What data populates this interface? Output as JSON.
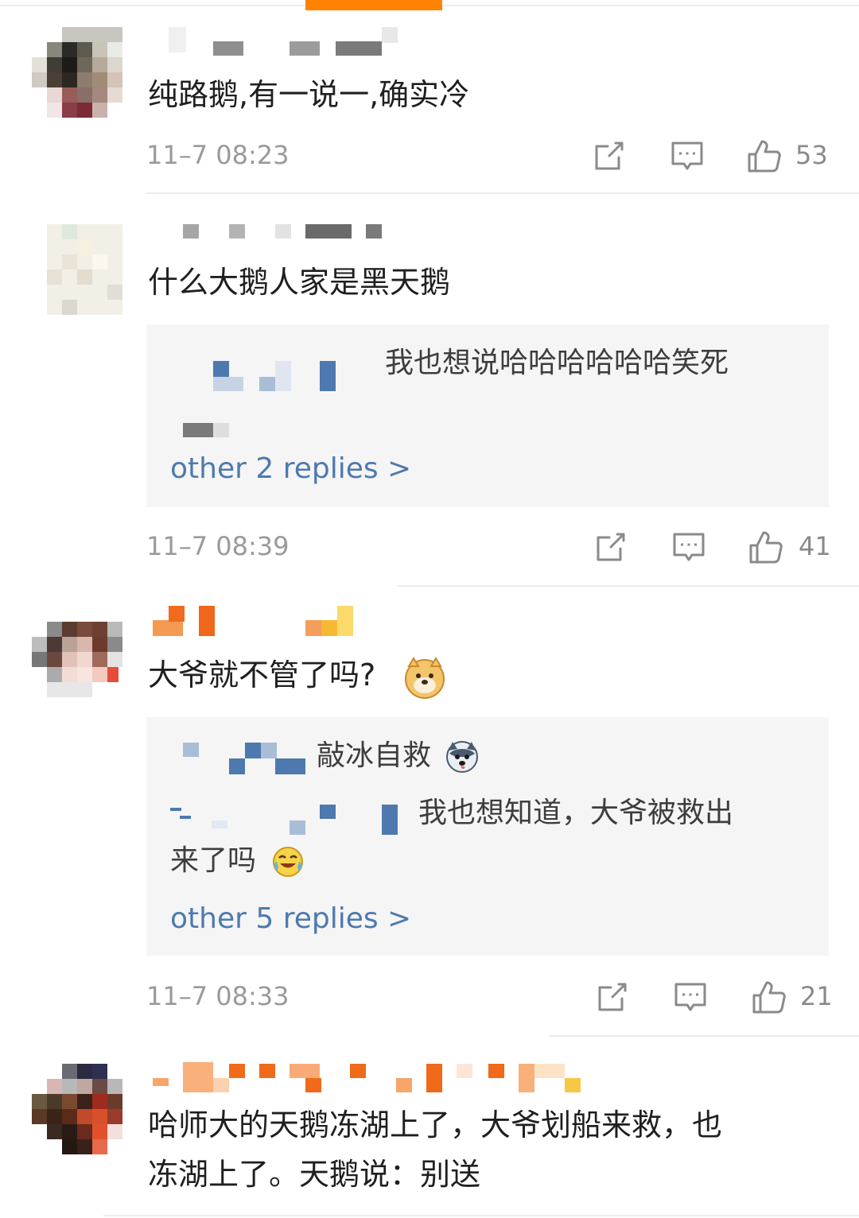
{
  "comments": [
    {
      "text": "纯路鹅,有一说一,确实冷",
      "time": "11–7 08:23",
      "likes": "53"
    },
    {
      "text": "什么大鹅人家是黑天鹅",
      "reply_preview": "我也想说哈哈哈哈哈哈笑死",
      "more_replies": "other 2 replies >",
      "time": "11–7 08:39",
      "likes": "41"
    },
    {
      "text": "大爷就不管了吗?",
      "text_emoji": "doge-emoji",
      "reply_1": "敲冰自救",
      "reply_1_emoji": "husky-emoji",
      "reply_2_line1": "我也想知道，大爷被救出",
      "reply_2_line2": "来了吗",
      "reply_2_emoji": "laugh-cry-emoji",
      "more_replies": "other 5 replies >",
      "time": "11–7 08:33",
      "likes": "21"
    },
    {
      "text_line1": "哈师大的天鹅冻湖上了，大爷划船来救，也",
      "text_line2": "冻湖上了。天鹅说：别送"
    }
  ],
  "icons": {
    "repost": "repost-icon",
    "comment": "comment-icon",
    "like": "thumbs-up-icon"
  },
  "colors": {
    "accent": "#ff8200",
    "link": "#4e79ae",
    "meta": "#9a9a9a",
    "reply_bg": "#f5f5f5"
  }
}
